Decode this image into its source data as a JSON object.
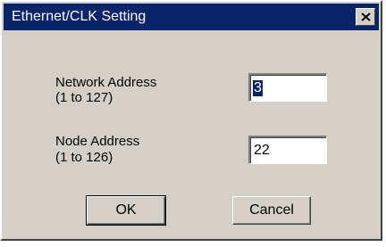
{
  "window": {
    "title": "Ethernet/CLK Setting",
    "close_icon": "close-icon"
  },
  "form": {
    "network_address": {
      "label_line1": "Network Address",
      "label_line2": "(1 to 127)",
      "value": "3"
    },
    "node_address": {
      "label_line1": "Node Address",
      "label_line2": "(1 to 126)",
      "value": "22"
    }
  },
  "buttons": {
    "ok_label": "OK",
    "cancel_label": "Cancel"
  },
  "colors": {
    "titlebar": "#0a246a",
    "face": "#d4d0c8",
    "selection": "#0a246a"
  }
}
